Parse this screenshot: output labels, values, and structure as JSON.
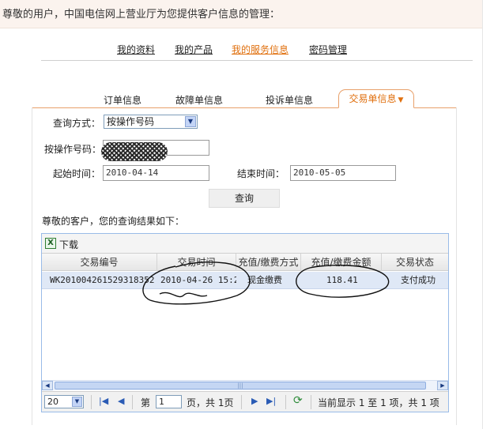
{
  "greeting": "尊敬的用户，中国电信网上营业厅为您提供客户信息的管理：",
  "top_nav": [
    {
      "label": "我的资料",
      "active": false
    },
    {
      "label": "我的产品",
      "active": false
    },
    {
      "label": "我的服务信息",
      "active": true
    },
    {
      "label": "密码管理",
      "active": false
    }
  ],
  "tabs": [
    {
      "label": "订单信息"
    },
    {
      "label": "故障单信息"
    },
    {
      "label": "投诉单信息"
    },
    {
      "label": "交易单信息",
      "active": true
    }
  ],
  "form": {
    "query_method_label": "查询方式：",
    "query_method_value": "按操作号码",
    "operation_number_label": "按操作号码：",
    "start_time_label": "起始时间：",
    "start_time_value": "2010-04-14",
    "end_time_label": "结束时间：",
    "end_time_value": "2010-05-05",
    "query_button": "查询"
  },
  "result_caption": "尊敬的客户，您的查询结果如下：",
  "grid": {
    "download_label": "下载",
    "columns": [
      "交易编号",
      "交易时间",
      "充值/缴费方式",
      "充值/缴费金额",
      "交易状态"
    ],
    "rows": [
      {
        "id": "WK201004261529318352",
        "time": "2010-04-26 15:2",
        "method": "现金缴费",
        "amount": "118.41",
        "status": "支付成功"
      }
    ]
  },
  "pager": {
    "page_size": "20",
    "page_prefix": "第",
    "page_value": "1",
    "page_suffix": "页，共 1页",
    "display_info": "当前显示 1 至 1 项，共 1 项"
  },
  "colors": {
    "accent_orange": "#e0700f",
    "grid_border": "#99bbe8",
    "selected_row": "#dfe8f6"
  }
}
